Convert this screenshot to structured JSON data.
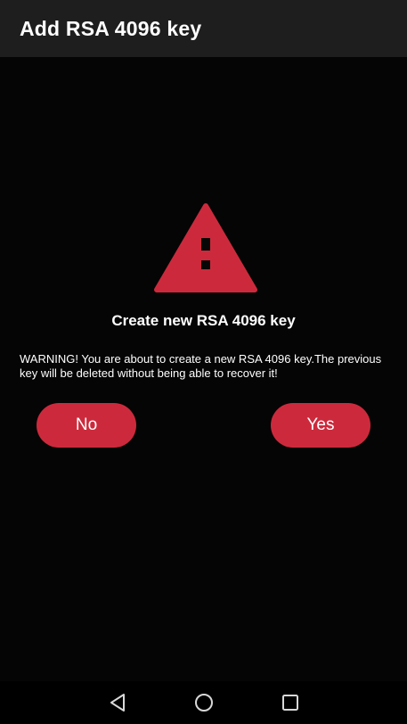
{
  "appbar": {
    "title": "Add RSA 4096 key"
  },
  "dialog": {
    "icon": "warning-triangle-icon",
    "heading": "Create new RSA 4096 key",
    "message": "WARNING! You are about to create a new RSA 4096 key.The previous key will be deleted without being able to recover it!",
    "no_label": "No",
    "yes_label": "Yes"
  },
  "navbar": {
    "icons": [
      "back-icon",
      "home-icon",
      "recents-icon"
    ]
  },
  "colors": {
    "accent": "#cc2a3c",
    "appbar": "#1e1e1e",
    "background": "#050505",
    "text": "#ffffff"
  }
}
